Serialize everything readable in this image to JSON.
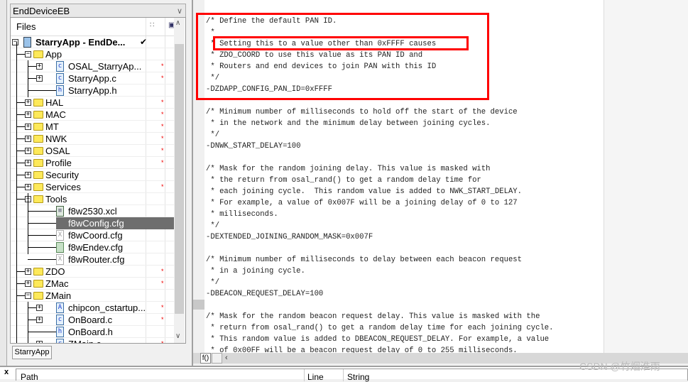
{
  "workspace": {
    "config": "EndDeviceEB",
    "files_header": "Files",
    "tab": "StarryApp"
  },
  "tree": [
    {
      "label": "StarryApp - EndDe...",
      "type": "project",
      "level": 0,
      "box": "-",
      "check": true
    },
    {
      "label": "App",
      "type": "folder",
      "level": 1,
      "box": "-"
    },
    {
      "label": "OSAL_StarryAp...",
      "type": "c",
      "level": 2,
      "box": "+",
      "star": true
    },
    {
      "label": "StarryApp.c",
      "type": "c",
      "level": 2,
      "box": "+",
      "star": true
    },
    {
      "label": "StarryApp.h",
      "type": "h",
      "level": 2
    },
    {
      "label": "HAL",
      "type": "folder",
      "level": 1,
      "box": "+",
      "star": true
    },
    {
      "label": "MAC",
      "type": "folder",
      "level": 1,
      "box": "+",
      "star": true
    },
    {
      "label": "MT",
      "type": "folder",
      "level": 1,
      "box": "+",
      "star": true
    },
    {
      "label": "NWK",
      "type": "folder",
      "level": 1,
      "box": "+",
      "star": true
    },
    {
      "label": "OSAL",
      "type": "folder",
      "level": 1,
      "box": "+",
      "star": true
    },
    {
      "label": "Profile",
      "type": "folder",
      "level": 1,
      "box": "+",
      "star": true
    },
    {
      "label": "Security",
      "type": "folder",
      "level": 1,
      "box": "+"
    },
    {
      "label": "Services",
      "type": "folder",
      "level": 1,
      "box": "+",
      "star": true
    },
    {
      "label": "Tools",
      "type": "folder",
      "level": 1,
      "box": "-"
    },
    {
      "label": "f8w2530.xcl",
      "type": "xcl",
      "level": 2
    },
    {
      "label": "f8wConfig.cfg",
      "type": "cfg",
      "level": 2,
      "selected": true
    },
    {
      "label": "f8wCoord.cfg",
      "type": "x",
      "level": 2
    },
    {
      "label": "f8wEndev.cfg",
      "type": "cfg",
      "level": 2
    },
    {
      "label": "f8wRouter.cfg",
      "type": "x",
      "level": 2
    },
    {
      "label": "ZDO",
      "type": "folder",
      "level": 1,
      "box": "+",
      "star": true
    },
    {
      "label": "ZMac",
      "type": "folder",
      "level": 1,
      "box": "+",
      "star": true
    },
    {
      "label": "ZMain",
      "type": "folder",
      "level": 1,
      "box": "-"
    },
    {
      "label": "chipcon_cstartup...",
      "type": "asm",
      "level": 2,
      "box": "+",
      "star": true
    },
    {
      "label": "OnBoard.c",
      "type": "c",
      "level": 2,
      "box": "+",
      "star": true
    },
    {
      "label": "OnBoard.h",
      "type": "h",
      "level": 2
    },
    {
      "label": "ZMain.c",
      "type": "c",
      "level": 2,
      "box": "+",
      "star": true
    }
  ],
  "editor": {
    "lines": [
      "/* Define the default PAN ID.",
      " *",
      " * Setting this to a value other than 0xFFFF causes",
      " * ZDO_COORD to use this value as its PAN ID and",
      " * Routers and end devices to join PAN with this ID",
      " */",
      "-DZDAPP_CONFIG_PAN_ID=0xFFFF",
      "",
      "/* Minimum number of milliseconds to hold off the start of the device",
      " * in the network and the minimum delay between joining cycles.",
      " */",
      "-DNWK_START_DELAY=100",
      "",
      "/* Mask for the random joining delay. This value is masked with",
      " * the return from osal_rand() to get a random delay time for",
      " * each joining cycle.  This random value is added to NWK_START_DELAY.",
      " * For example, a value of 0x007F will be a joining delay of 0 to 127",
      " * milliseconds.",
      " */",
      "-DEXTENDED_JOINING_RANDOM_MASK=0x007F",
      "",
      "/* Minimum number of milliseconds to delay between each beacon request",
      " * in a joining cycle.",
      " */",
      "-DBEACON_REQUEST_DELAY=100",
      "",
      "/* Mask for the random beacon request delay. This value is masked with the",
      " * return from osal_rand() to get a random delay time for each joining cycle.",
      " * This random value is added to DBEACON_REQUEST_DELAY. For example, a value",
      " * of 0x00FF will be a beacon request delay of 0 to 255 milliseconds."
    ],
    "func_button": "f()"
  },
  "bottom": {
    "close": "x",
    "headers": [
      "Path",
      "Line",
      "String"
    ]
  },
  "watermark": "CSDN @竹烟淮雨",
  "colors": {
    "highlight": "#ff0000",
    "selected_row": "#6e6e6e"
  }
}
